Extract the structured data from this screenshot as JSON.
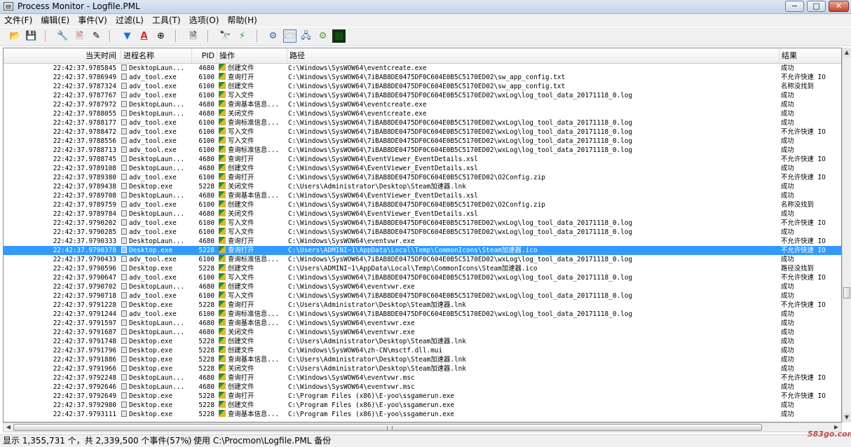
{
  "window": {
    "title": "Process Monitor - Logfile.PML",
    "minimize": "−",
    "maximize": "□",
    "close": "✕"
  },
  "menu": [
    "文件(F)",
    "编辑(E)",
    "事件(V)",
    "过滤(L)",
    "工具(T)",
    "选项(O)",
    "帮助(H)"
  ],
  "toolbar_icons": [
    {
      "name": "open-icon",
      "glyph": "📂"
    },
    {
      "name": "save-icon",
      "glyph": "💾"
    },
    {
      "name": "capture-icon",
      "glyph": "🔧"
    },
    {
      "name": "autoscroll-icon",
      "glyph": "🖹"
    },
    {
      "name": "clear-icon",
      "glyph": "✎"
    },
    {
      "name": "filter-icon",
      "glyph": "▼"
    },
    {
      "name": "highlight-icon",
      "glyph": "A"
    },
    {
      "name": "target-icon",
      "glyph": "⊕"
    },
    {
      "name": "process-tree-icon",
      "glyph": "🗎"
    },
    {
      "name": "find-icon",
      "glyph": "🔭"
    },
    {
      "name": "jump-icon",
      "glyph": "⚡"
    },
    {
      "name": "registry-icon",
      "glyph": "⚙"
    },
    {
      "name": "filesystem-icon",
      "glyph": "🗁"
    },
    {
      "name": "network-icon",
      "glyph": "🖧"
    },
    {
      "name": "process-thread-icon",
      "glyph": "⚙"
    },
    {
      "name": "profiling-icon",
      "glyph": "▤"
    }
  ],
  "columns": {
    "time": "当天时间",
    "process": "进程名称",
    "pid": "PID",
    "operation": "操作",
    "path": "路径",
    "result": "结果"
  },
  "rows": [
    [
      "22:42:37.9785845",
      "DesktopLaun...",
      "4680",
      "创建文件",
      "C:\\Windows\\SysWOW64\\eventcreate.exe",
      "成功"
    ],
    [
      "22:42:37.9786949",
      "adv_tool.exe",
      "6100",
      "查询打开",
      "C:\\Windows\\SysWOW64\\7iBAB8DE0475DF0C604E0B5C5170ED02\\sw_app_config.txt",
      "不允许快速 IO"
    ],
    [
      "22:42:37.9787324",
      "adv_tool.exe",
      "6100",
      "创建文件",
      "C:\\Windows\\SysWOW64\\7iBAB8DE0475DF0C604E0B5C5170ED02\\sw_app_config.txt",
      "名称没找到"
    ],
    [
      "22:42:37.9787767",
      "adv_tool.exe",
      "6100",
      "写入文件",
      "C:\\Windows\\SysWOW64\\7iBAB8DE0475DF0C604E0B5C5170ED02\\wxLog\\log_tool_data_20171118_0.log",
      "成功"
    ],
    [
      "22:42:37.9787972",
      "DesktopLaun...",
      "4680",
      "查询基本信息...",
      "C:\\Windows\\SysWOW64\\eventcreate.exe",
      "成功"
    ],
    [
      "22:42:37.9788055",
      "DesktopLaun...",
      "4680",
      "关闭文件",
      "C:\\Windows\\SysWOW64\\eventcreate.exe",
      "成功"
    ],
    [
      "22:42:37.9788177",
      "adv_tool.exe",
      "6100",
      "查询标准信息...",
      "C:\\Windows\\SysWOW64\\7iBAB8DE0475DF0C604E0B5C5170ED02\\wxLog\\log_tool_data_20171118_0.log",
      "成功"
    ],
    [
      "22:42:37.9788472",
      "adv_tool.exe",
      "6100",
      "写入文件",
      "C:\\Windows\\SysWOW64\\7iBAB8DE0475DF0C604E0B5C5170ED02\\wxLog\\log_tool_data_20171118_0.log",
      "不允许快速 IO"
    ],
    [
      "22:42:37.9788556",
      "adv_tool.exe",
      "6100",
      "写入文件",
      "C:\\Windows\\SysWOW64\\7iBAB8DE0475DF0C604E0B5C5170ED02\\wxLog\\log_tool_data_20171118_0.log",
      "成功"
    ],
    [
      "22:42:37.9788713",
      "adv_tool.exe",
      "6100",
      "查询标准信息...",
      "C:\\Windows\\SysWOW64\\7iBAB8DE0475DF0C604E0B5C5170ED02\\wxLog\\log_tool_data_20171118_0.log",
      "成功"
    ],
    [
      "22:42:37.9788745",
      "DesktopLaun...",
      "4680",
      "查询打开",
      "C:\\Windows\\SysWOW64\\EventViewer_EventDetails.xsl",
      "不允许快速 IO"
    ],
    [
      "22:42:37.9789108",
      "DesktopLaun...",
      "4680",
      "创建文件",
      "C:\\Windows\\SysWOW64\\EventViewer_EventDetails.xsl",
      "成功"
    ],
    [
      "22:42:37.9789380",
      "adv_tool.exe",
      "6100",
      "查询打开",
      "C:\\Windows\\SysWOW64\\7iBAB8DE0475DF0C604E0B5C5170ED02\\O2Config.zip",
      "不允许快速 IO"
    ],
    [
      "22:42:37.9789438",
      "Desktop.exe",
      "5228",
      "关闭文件",
      "C:\\Users\\Administrator\\Desktop\\Steam加速器.lnk",
      "成功"
    ],
    [
      "22:42:37.9789708",
      "DesktopLaun...",
      "4680",
      "查询基本信息...",
      "C:\\Windows\\SysWOW64\\EventViewer_EventDetails.xsl",
      "成功"
    ],
    [
      "22:42:37.9789759",
      "adv_tool.exe",
      "6100",
      "创建文件",
      "C:\\Windows\\SysWOW64\\7iBAB8DE0475DF0C604E0B5C5170ED02\\O2Config.zip",
      "名称没找到"
    ],
    [
      "22:42:37.9789784",
      "DesktopLaun...",
      "4680",
      "关闭文件",
      "C:\\Windows\\SysWOW64\\EventViewer_EventDetails.xsl",
      "成功"
    ],
    [
      "22:42:37.9790202",
      "adv_tool.exe",
      "6100",
      "写入文件",
      "C:\\Windows\\SysWOW64\\7iBAB8DE0475DF0C604E0B5C5170ED02\\wxLog\\log_tool_data_20171118_0.log",
      "不允许快速 IO"
    ],
    [
      "22:42:37.9790285",
      "adv_tool.exe",
      "6100",
      "写入文件",
      "C:\\Windows\\SysWOW64\\7iBAB8DE0475DF0C604E0B5C5170ED02\\wxLog\\log_tool_data_20171118_0.log",
      "成功"
    ],
    [
      "22:42:37.9790333",
      "DesktopLaun...",
      "4680",
      "查询打开",
      "C:\\Windows\\SysWOW64\\eventvwr.exe",
      "不允许快速 IO"
    ],
    [
      "22:42:37.9790378",
      "Desktop.exe",
      "5228",
      "查询打开",
      "C:\\Users\\ADMINI~1\\AppData\\Local\\Temp\\CommonIcons\\Steam加速器.ico",
      "不允许快速 IO"
    ],
    [
      "22:42:37.9790433",
      "adv_tool.exe",
      "6100",
      "查询标准信息...",
      "C:\\Windows\\SysWOW64\\7iBAB8DE0475DF0C604E0B5C5170ED02\\wxLog\\log_tool_data_20171118_0.log",
      "成功"
    ],
    [
      "22:42:37.9790596",
      "Desktop.exe",
      "5228",
      "创建文件",
      "C:\\Users\\ADMINI~1\\AppData\\Local\\Temp\\CommonIcons\\Steam加速器.ico",
      "路径没找到"
    ],
    [
      "22:42:37.9790647",
      "adv_tool.exe",
      "6100",
      "写入文件",
      "C:\\Windows\\SysWOW64\\7iBAB8DE0475DF0C604E0B5C5170ED02\\wxLog\\log_tool_data_20171118_0.log",
      "不允许快速 IO"
    ],
    [
      "22:42:37.9790702",
      "DesktopLaun...",
      "4680",
      "创建文件",
      "C:\\Windows\\SysWOW64\\eventvwr.exe",
      "成功"
    ],
    [
      "22:42:37.9790718",
      "adv_tool.exe",
      "6100",
      "写入文件",
      "C:\\Windows\\SysWOW64\\7iBAB8DE0475DF0C604E0B5C5170ED02\\wxLog\\log_tool_data_20171118_0.log",
      "成功"
    ],
    [
      "22:42:37.9791228",
      "Desktop.exe",
      "5228",
      "查询打开",
      "C:\\Users\\Administrator\\Desktop\\Steam加速器.lnk",
      "不允许快速 IO"
    ],
    [
      "22:42:37.9791244",
      "adv_tool.exe",
      "6100",
      "查询标准信息...",
      "C:\\Windows\\SysWOW64\\7iBAB8DE0475DF0C604E0B5C5170ED02\\wxLog\\log_tool_data_20171118_0.log",
      "成功"
    ],
    [
      "22:42:37.9791597",
      "DesktopLaun...",
      "4680",
      "查询基本信息...",
      "C:\\Windows\\SysWOW64\\eventvwr.exe",
      "成功"
    ],
    [
      "22:42:37.9791687",
      "DesktopLaun...",
      "4680",
      "关闭文件",
      "C:\\Windows\\SysWOW64\\eventvwr.exe",
      "成功"
    ],
    [
      "22:42:37.9791748",
      "Desktop.exe",
      "5228",
      "创建文件",
      "C:\\Users\\Administrator\\Desktop\\Steam加速器.lnk",
      "成功"
    ],
    [
      "22:42:37.9791796",
      "Desktop.exe",
      "5228",
      "创建文件",
      "C:\\Windows\\SysWOW64\\zh-CN\\msctf.dll.mui",
      "成功"
    ],
    [
      "22:42:37.9791886",
      "Desktop.exe",
      "5228",
      "查询基本信息...",
      "C:\\Users\\Administrator\\Desktop\\Steam加速器.lnk",
      "成功"
    ],
    [
      "22:42:37.9791966",
      "Desktop.exe",
      "5228",
      "关闭文件",
      "C:\\Users\\Administrator\\Desktop\\Steam加速器.lnk",
      "成功"
    ],
    [
      "22:42:37.9792248",
      "DesktopLaun...",
      "4680",
      "查询打开",
      "C:\\Windows\\SysWOW64\\eventvwr.msc",
      "不允许快速 IO"
    ],
    [
      "22:42:37.9792646",
      "DesktopLaun...",
      "4680",
      "创建文件",
      "C:\\Windows\\SysWOW64\\eventvwr.msc",
      "成功"
    ],
    [
      "22:42:37.9792649",
      "Desktop.exe",
      "5228",
      "查询打开",
      "C:\\Program Files (x86)\\E-yoo\\ssgamerun.exe",
      "不允许快速 IO"
    ],
    [
      "22:42:37.9792980",
      "Desktop.exe",
      "5228",
      "创建文件",
      "C:\\Program Files (x86)\\E-yoo\\ssgamerun.exe",
      "成功"
    ],
    [
      "22:42:37.9793111",
      "Desktop.exe",
      "5228",
      "查询基本信息...",
      "C:\\Program Files (x86)\\E-yoo\\ssgamerun.exe",
      "成功"
    ]
  ],
  "selected_row_index": 20,
  "status": {
    "events": "显示 1,355,731 个，共 2,339,500 个事件(57%)",
    "backing": "使用 C:\\Procmon\\Logfile.PML 备份"
  },
  "watermark": "583go.com",
  "colors": {
    "selection": "#3399ff",
    "titlebar": "#c4d6ea",
    "close_button": "#c6452f"
  }
}
